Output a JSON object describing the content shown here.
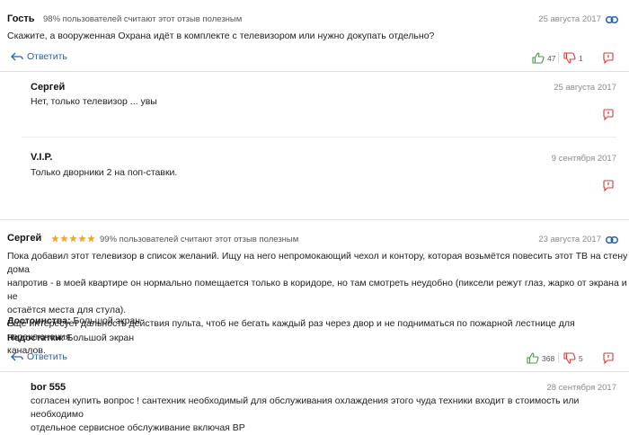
{
  "review1": {
    "author": "Гость",
    "helpful": "98% пользователей считают этот отзыв полезным",
    "date": "25 августа 2017",
    "text": "Скажите, а вооруженная Охрана идёт в комплекте с телевизором или нужно докупать отдельно?",
    "reply_label": "Ответить",
    "likes": "47",
    "dislikes": "1",
    "replies": [
      {
        "author": "Сергей",
        "date": "25 августа 2017",
        "text": "Нет, только телевизор ... увы"
      },
      {
        "author": "V.I.P.",
        "date": "9 сентября 2017",
        "text": "Только дворники 2 на поп-ставки."
      }
    ]
  },
  "review2": {
    "author": "Сергей",
    "rating_stars": 5,
    "helpful": "99% пользователей считают этот отзыв полезным",
    "date": "23 августа 2017",
    "text_lines": [
      "Пока добавил этот телевизор в список желаний. Ищу на него непромокающий чехол и контору, которая возьмётся повесить этот ТВ на стену дома",
      "напротив - в моей квартире он нормально помещается только в коридоре, но там смотреть неудобно (пиксели режут глаз, жарко от экрана и не",
      "остаётся места для стула).",
      "Ещё интересует дальность действия пульта, чтоб не бегать каждый раз через двор и не подниматься по пожарной лестнице для переключения",
      "каналов."
    ],
    "pros_label": "Достоинства:",
    "pros_value": "Большой экран",
    "cons_label": "Недостатки:",
    "cons_value": "Большой экран",
    "reply_label": "Ответить",
    "likes": "368",
    "dislikes": "5",
    "replies": [
      {
        "author": "bor 555",
        "date": "28 сентября 2017",
        "text_lines": [
          "согласен купить вопрос ! сантехник необходимый для обслуживания охлаждения этого чуда техники входит в стоимость или необходимо",
          "отдельное сервисное обслуживание включая ВР"
        ]
      }
    ]
  },
  "colors": {
    "link": "#2a63a8",
    "like": "#3aa23a",
    "dislike": "#d33a3a",
    "star": "#f5a623"
  }
}
